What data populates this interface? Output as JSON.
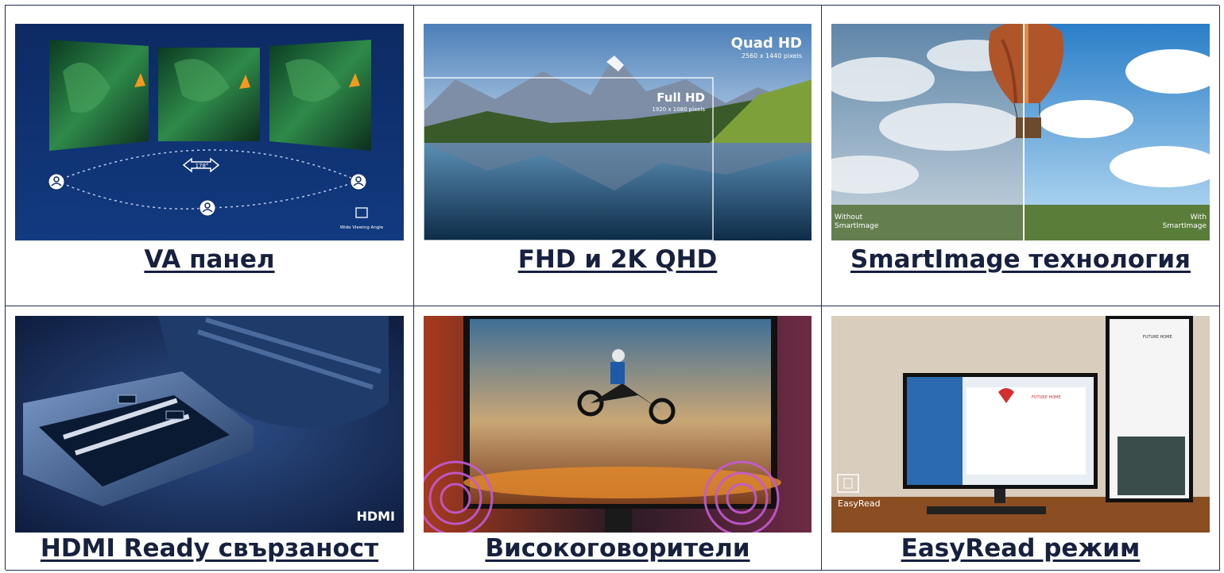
{
  "cards": [
    {
      "caption": "VA панел",
      "overlay": {
        "angle": "178°",
        "badge": "Wide Viewing Angle"
      }
    },
    {
      "caption": "FHD и 2K QHD",
      "overlay": {
        "qhd_title": "Quad HD",
        "qhd_sub": "2560 x 1440 pixels",
        "fhd_title": "Full HD",
        "fhd_sub": "1920 x 1080 pixels"
      }
    },
    {
      "caption": "SmartImage технология",
      "overlay": {
        "left": "Without SmartImage",
        "right": "With SmartImage"
      }
    },
    {
      "caption": "HDMI Ready свързаност",
      "overlay": {
        "brand": "HDMI"
      }
    },
    {
      "caption": "Високоговорители",
      "overlay": {}
    },
    {
      "caption": "EasyRead режим",
      "overlay": {
        "badge": "EasyRead",
        "doc_title": "FUTURE HOME"
      }
    }
  ],
  "colors": {
    "border": "#1e2d5a",
    "caption": "#17213f"
  }
}
